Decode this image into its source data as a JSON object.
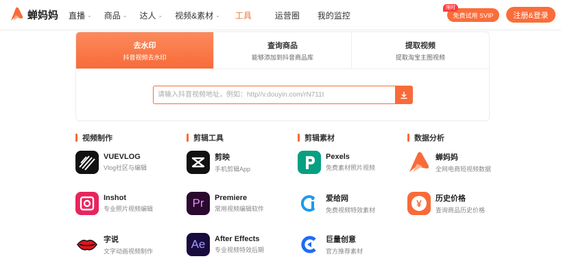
{
  "header": {
    "logo_text": "蝉妈妈",
    "nav": [
      {
        "label": "直播",
        "dropdown": true
      },
      {
        "label": "商品",
        "dropdown": true
      },
      {
        "label": "达人",
        "dropdown": true
      },
      {
        "label": "视频&素材",
        "dropdown": true
      },
      {
        "label": "工具",
        "dropdown": false,
        "active": true
      },
      {
        "label": "运营圈",
        "dropdown": false
      },
      {
        "label": "我的监控",
        "dropdown": false
      }
    ],
    "trial_badge": "限时",
    "trial_button": "免费试用 SVIP",
    "login_button": "注册&登录"
  },
  "tool": {
    "tabs": [
      {
        "title": "去水印",
        "desc": "抖音视频去水印",
        "active": true
      },
      {
        "title": "查询商品",
        "desc": "能够添加到抖音商品库",
        "active": false
      },
      {
        "title": "提取视频",
        "desc": "提取淘宝主图视频",
        "active": false
      }
    ],
    "search_placeholder": "请输入抖音视频地址，例如：http//v.douyin.com/rN711t"
  },
  "categories": [
    {
      "title": "视频制作",
      "apps": [
        {
          "name": "VUEVLOG",
          "desc": "Vlog社区与编辑",
          "icon": "vuevlog-icon"
        },
        {
          "name": "Inshot",
          "desc": "专业照片视频编辑",
          "icon": "inshot-icon"
        },
        {
          "name": "字说",
          "desc": "文字动画视频制作",
          "icon": "lips-icon"
        }
      ]
    },
    {
      "title": "剪辑工具",
      "apps": [
        {
          "name": "剪映",
          "desc": "手机剪辑App",
          "icon": "capcut-icon"
        },
        {
          "name": "Premiere",
          "desc": "常用视频编辑软件",
          "icon": "premiere-icon",
          "glyph": "Pr"
        },
        {
          "name": "After Effects",
          "desc": "专业视频特效后期",
          "icon": "after-effects-icon",
          "glyph": "Ae"
        }
      ]
    },
    {
      "title": "剪辑素材",
      "apps": [
        {
          "name": "Pexels",
          "desc": "免费素材照片视频",
          "icon": "pexels-icon"
        },
        {
          "name": "爱给网",
          "desc": "免费视频特效素材",
          "icon": "aigei-icon"
        },
        {
          "name": "巨量创意",
          "desc": "官方推荐素材",
          "icon": "juliang-icon"
        }
      ]
    },
    {
      "title": "数据分析",
      "apps": [
        {
          "name": "蝉妈妈",
          "desc": "全网电商短视频数据",
          "icon": "chanmama-icon"
        },
        {
          "name": "历史价格",
          "desc": "查询商品历史价格",
          "icon": "price-history-icon",
          "glyph": "¥"
        }
      ]
    }
  ],
  "colors": {
    "accent": "#f86b39",
    "premiere_bg": "#2a0a2e",
    "premiere_fg": "#e88bff",
    "ae_bg": "#1a0b3d",
    "ae_fg": "#a29cff",
    "pexels": "#05a081",
    "inshot": "#e8245c"
  }
}
